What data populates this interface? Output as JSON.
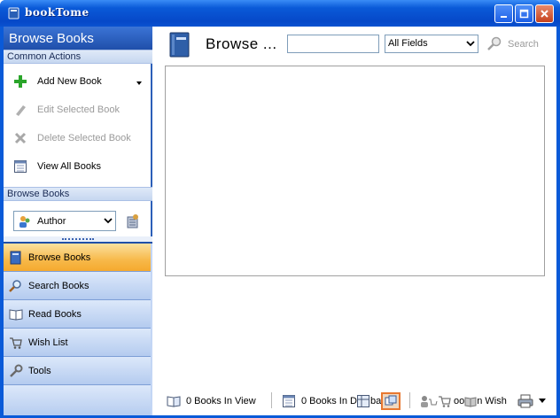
{
  "window": {
    "title": "bookTome",
    "accent": "#0a5ad8"
  },
  "sidebar": {
    "header": "Browse Books",
    "common_actions_label": "Common Actions",
    "actions": [
      {
        "label": "Add New Book",
        "icon": "plus-icon",
        "enabled": true
      },
      {
        "label": "Edit Selected Book",
        "icon": "pencil-icon",
        "enabled": false
      },
      {
        "label": "Delete Selected Book",
        "icon": "x-icon",
        "enabled": false
      },
      {
        "label": "View All Books",
        "icon": "calendar-grid-icon",
        "enabled": true
      }
    ],
    "browse_section_label": "Browse Books",
    "browse_by": {
      "selected": "Author"
    },
    "nav": [
      {
        "label": "Browse Books",
        "icon": "book-icon",
        "active": true
      },
      {
        "label": "Search Books",
        "icon": "magnifier-icon",
        "active": false
      },
      {
        "label": "Read Books",
        "icon": "open-book-icon",
        "active": false
      },
      {
        "label": "Wish List",
        "icon": "cart-icon",
        "active": false
      },
      {
        "label": "Tools",
        "icon": "wrench-icon",
        "active": false
      }
    ],
    "active_color": "#f5a92e"
  },
  "main": {
    "title": "Browse ...",
    "search": {
      "value": "",
      "placeholder": ""
    },
    "field_select": {
      "selected": "All Fields"
    },
    "search_button": "Search"
  },
  "status": {
    "books_in_view": "0 Books In View",
    "books_in_db": "0 Books In D",
    "books_in_db_tail": "ba",
    "wish_text_a": "oo",
    "wish_text_b": "n Wish"
  }
}
